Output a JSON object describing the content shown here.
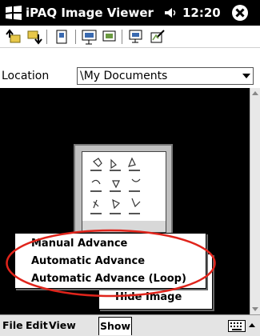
{
  "title_bar": {
    "app_title": "iPAQ Image Viewer",
    "time": "12:20",
    "icons": [
      "windows-start-icon",
      "speaker-icon",
      "close-icon"
    ]
  },
  "toolbar": {
    "buttons": [
      "up-folder-icon",
      "down-folder-icon",
      "page-icon",
      "slideshow-icon",
      "image-tool-icon",
      "edit-image-icon"
    ]
  },
  "location": {
    "label": "Location",
    "value": "\\My Documents"
  },
  "show_submenu": {
    "items": [
      {
        "label": "Manual Advance"
      },
      {
        "label": "Automatic Advance"
      },
      {
        "label": "Automatic Advance (Loop)"
      }
    ]
  },
  "show_menu": {
    "hide_image": "Hide Image"
  },
  "menu_bar": {
    "file": "File",
    "edit": "Edit",
    "view": "View",
    "show": "Show"
  },
  "colors": {
    "title_bg": "#000000",
    "viewer_bg": "#000000",
    "highlight": "#e0241b"
  }
}
